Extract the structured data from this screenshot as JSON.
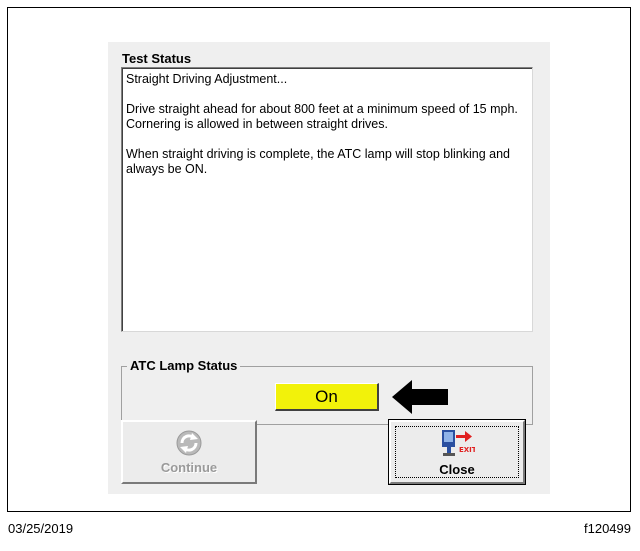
{
  "dialog": {
    "test_status_heading": "Test Status",
    "status_lines": [
      "Straight Driving Adjustment...",
      "Drive straight ahead for about 800 feet at a minimum speed of 15 mph.  Cornering is allowed in between straight drives.",
      "When straight driving is complete, the ATC lamp will stop blinking and always be ON."
    ],
    "lamp_group_title": "ATC Lamp Status",
    "lamp_value": "On",
    "lamp_color": "#f2f20a",
    "continue_button": {
      "label": "Continue",
      "enabled": false,
      "icon": "refresh-arrows-icon"
    },
    "close_button": {
      "label": "Close",
      "enabled": true,
      "icon": "exit-icon"
    }
  },
  "footer": {
    "date": "03/25/2019",
    "figure_id": "f120499"
  }
}
